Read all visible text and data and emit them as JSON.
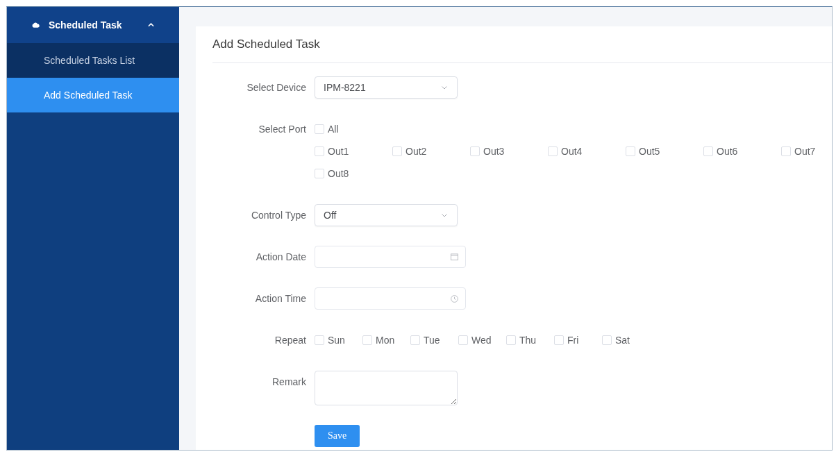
{
  "sidebar": {
    "group": {
      "label": "Scheduled Task",
      "expanded": true
    },
    "items": [
      {
        "label": "Scheduled Tasks List",
        "selected": false
      },
      {
        "label": "Add Scheduled Task",
        "selected": true
      }
    ]
  },
  "form": {
    "title": "Add Scheduled Task",
    "fields": [
      {
        "kind": "select",
        "label": "Select Device",
        "value": "IPM-8221"
      },
      {
        "kind": "ports",
        "label": "Select Port",
        "all": {
          "label": "All",
          "checked": false
        },
        "options": [
          {
            "label": "Out1",
            "checked": false
          },
          {
            "label": "Out2",
            "checked": false
          },
          {
            "label": "Out3",
            "checked": false
          },
          {
            "label": "Out4",
            "checked": false
          },
          {
            "label": "Out5",
            "checked": false
          },
          {
            "label": "Out6",
            "checked": false
          },
          {
            "label": "Out7",
            "checked": false
          },
          {
            "label": "Out8",
            "checked": false
          }
        ]
      },
      {
        "kind": "select",
        "label": "Control Type",
        "value": "Off"
      },
      {
        "kind": "date",
        "label": "Action Date"
      },
      {
        "kind": "time",
        "label": "Action Time"
      },
      {
        "kind": "days",
        "label": "Repeat",
        "options": [
          {
            "label": "Sun",
            "checked": false
          },
          {
            "label": "Mon",
            "checked": false
          },
          {
            "label": "Tue",
            "checked": false
          },
          {
            "label": "Wed",
            "checked": false
          },
          {
            "label": "Thu",
            "checked": false
          },
          {
            "label": "Fri",
            "checked": false
          },
          {
            "label": "Sat",
            "checked": false
          }
        ]
      },
      {
        "kind": "textarea",
        "label": "Remark"
      }
    ],
    "save_button": "Save"
  }
}
